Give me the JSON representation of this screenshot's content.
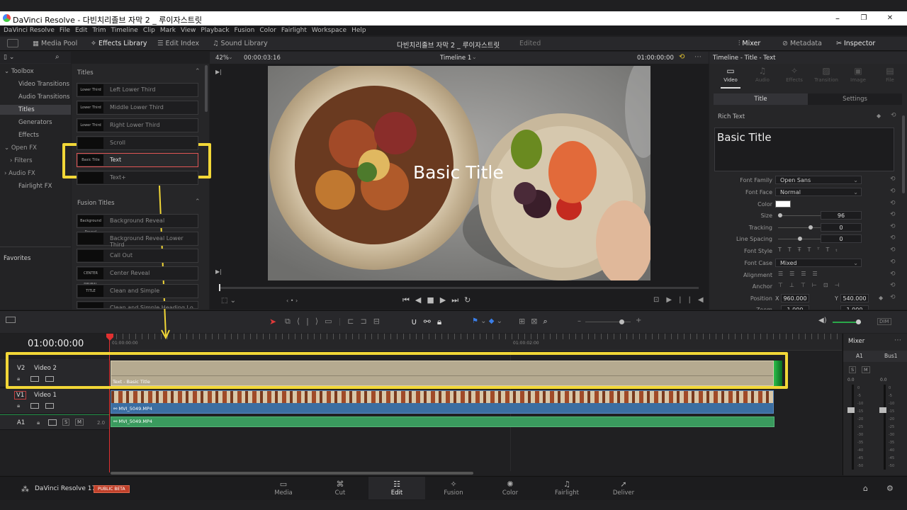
{
  "window": {
    "title": "DaVinci Resolve - 다빈치리졸브 자막 2 _ 루이자스트릿",
    "minimize": "–",
    "maximize": "❐",
    "close": "✕"
  },
  "menu": [
    "DaVinci Resolve",
    "File",
    "Edit",
    "Trim",
    "Timeline",
    "Clip",
    "Mark",
    "View",
    "Playback",
    "Fusion",
    "Color",
    "Fairlight",
    "Workspace",
    "Help"
  ],
  "toolbar": {
    "media_pool": "Media Pool",
    "effects_library": "Effects Library",
    "edit_index": "Edit Index",
    "sound_library": "Sound Library",
    "project_name": "다빈치리졸브 자막 2 _ 루이자스트릿",
    "project_status": "Edited",
    "mixer": "Mixer",
    "metadata": "Metadata",
    "inspector": "Inspector"
  },
  "viewer_bar": {
    "zoom": "42%",
    "source_tc": "00:00:03:16",
    "timeline_name": "Timeline 1",
    "record_tc": "01:00:00:00"
  },
  "toolbox": {
    "header": "Toolbox",
    "items": [
      "Video Transitions",
      "Audio Transitions",
      "Titles",
      "Generators",
      "Effects"
    ],
    "openfx": "Open FX",
    "filters": "Filters",
    "audiofx": "Audio FX",
    "fairlightfx": "Fairlight FX",
    "favorites": "Favorites"
  },
  "titles_section": {
    "header": "Titles",
    "items": [
      {
        "label": "Left Lower Third",
        "thumb": "Lower Third"
      },
      {
        "label": "Middle Lower Third",
        "thumb": "Lower Third"
      },
      {
        "label": "Right Lower Third",
        "thumb": "Lower Third"
      },
      {
        "label": "Scroll",
        "thumb": ""
      },
      {
        "label": "Text",
        "thumb": "Basic Title"
      },
      {
        "label": "Text+",
        "thumb": ""
      }
    ]
  },
  "fusion_titles": {
    "header": "Fusion Titles",
    "items": [
      {
        "label": "Background Reveal",
        "thumb": "Background Reveal"
      },
      {
        "label": "Background Reveal Lower Third",
        "thumb": ""
      },
      {
        "label": "Call Out",
        "thumb": ""
      },
      {
        "label": "Center Reveal",
        "thumb": "CENTER REVEAL"
      },
      {
        "label": "Clean and Simple",
        "thumb": "TITLE"
      },
      {
        "label": "Clean and Simple Heading Lo",
        "thumb": ""
      }
    ]
  },
  "viewer": {
    "overlay_text": "Basic Title"
  },
  "inspector": {
    "breadcrumb": "Timeline - Title - Text",
    "tabs": [
      "Video",
      "Audio",
      "Effects",
      "Transition",
      "Image",
      "File"
    ],
    "subtabs": [
      "Title",
      "Settings"
    ],
    "rich_text_label": "Rich Text",
    "rich_text_value": "Basic Title",
    "props": {
      "font_family_label": "Font Family",
      "font_family": "Open Sans",
      "font_face_label": "Font Face",
      "font_face": "Normal",
      "color_label": "Color",
      "color": "#ffffff",
      "size_label": "Size",
      "size": "96",
      "size_fraction": 0.02,
      "tracking_label": "Tracking",
      "tracking": "0",
      "tracking_fraction": 0.5,
      "line_spacing_label": "Line Spacing",
      "line_spacing": "0",
      "line_spacing_fraction": 0.33,
      "font_style_label": "Font Style",
      "font_case_label": "Font Case",
      "font_case": "Mixed",
      "alignment_label": "Alignment",
      "anchor_label": "Anchor",
      "position_label": "Position",
      "pos_x_label": "X",
      "pos_x": "960.000",
      "pos_y_label": "Y",
      "pos_y": "540.000",
      "zoom_label": "Zoom",
      "zoom_x": "1.000",
      "zoom_y": "1.000"
    }
  },
  "timeline": {
    "timecode": "01:00:00:00",
    "ruler_marks": [
      "01:00:00:00",
      "01:00:02:00"
    ],
    "tracks": {
      "v2": {
        "id": "V2",
        "name": "Video 2",
        "clip": "Text - Basic Title"
      },
      "v1": {
        "id": "V1",
        "name": "Video 1",
        "clip": "MVI_5049.MP4"
      },
      "a1": {
        "id": "A1",
        "channels": "2.0",
        "clip": "MVI_5049.MP4",
        "solo": "S",
        "mute": "M"
      }
    }
  },
  "mixer": {
    "header": "Mixer",
    "ch1": "A1",
    "ch2": "Bus1",
    "s": "S",
    "m": "M",
    "level1": "0.0",
    "level2": "0.0",
    "scale": [
      "0",
      "-5",
      "-10",
      "-15",
      "-20",
      "-25",
      "-30",
      "-35",
      "-40",
      "-45",
      "-50"
    ]
  },
  "footer": {
    "app_name": "DaVinci Resolve 17",
    "badge": "PUBLIC BETA",
    "pages": [
      "Media",
      "Cut",
      "Edit",
      "Fusion",
      "Color",
      "Fairlight",
      "Deliver"
    ],
    "active_page": "Edit"
  },
  "colors": {
    "accent_yellow": "#f2d737",
    "selected_red": "#e05555",
    "v2_clip": "#b5aa90",
    "v1_clip": "#3b6ea2",
    "a1_clip": "#3a9a5e",
    "playhead": "#e03030"
  }
}
